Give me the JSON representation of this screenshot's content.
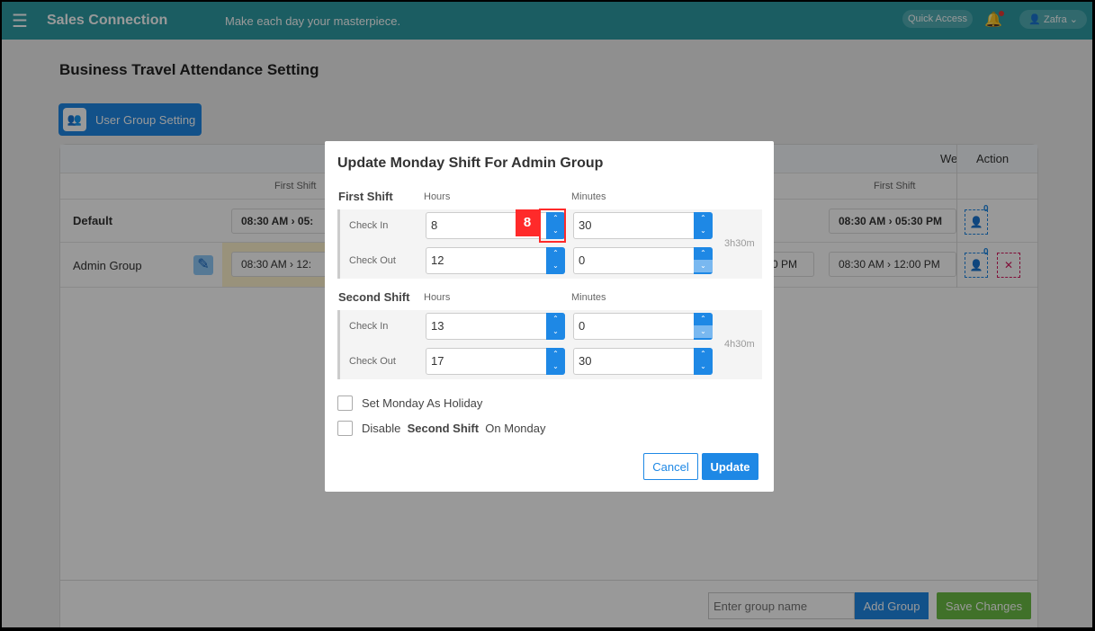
{
  "header": {
    "app_name": "Sales Connection",
    "tagline": "Make each day your masterpiece.",
    "quick_access": "Quick Access",
    "user": "Zafra",
    "colors": {
      "header": "#2d9ca3",
      "accent": "#1e88e5",
      "save": "#6bbd45",
      "marker": "#ff2a2a"
    }
  },
  "page": {
    "title": "Business Travel Attendance Setting",
    "user_group_button": "User Group Setting"
  },
  "table": {
    "right_day_header": "We",
    "action_header": "Action",
    "sub_header": "First Shift",
    "rows": [
      {
        "name": "Default",
        "left_time": "08:30 AM",
        "left_time_end": "05:",
        "right_start": "08:30 AM",
        "right_end": "05:30 PM",
        "count": "0"
      },
      {
        "name": "Admin Group",
        "left_time": "08:30 AM",
        "left_time_end": "12:",
        "mid_end": "0 PM",
        "right_start": "08:30 AM",
        "right_end": "12:00 PM",
        "count": "0"
      }
    ]
  },
  "footer": {
    "group_placeholder": "Enter group name",
    "add_group": "Add Group",
    "save_changes": "Save Changes"
  },
  "modal": {
    "title": "Update Monday Shift For Admin Group",
    "hours_label": "Hours",
    "minutes_label": "Minutes",
    "check_in": "Check In",
    "check_out": "Check Out",
    "first_shift": {
      "label": "First Shift",
      "in_hours": "8",
      "in_minutes": "30",
      "out_hours": "12",
      "out_minutes": "0",
      "duration": "3h30m"
    },
    "second_shift": {
      "label": "Second Shift",
      "in_hours": "13",
      "in_minutes": "0",
      "out_hours": "17",
      "out_minutes": "30",
      "duration": "4h30m"
    },
    "holiday_label": "Set Monday As Holiday",
    "disable_pre": "Disable ",
    "disable_bold": "Second Shift",
    "disable_post": " On Monday",
    "holiday_checked": false,
    "disable_checked": false,
    "cancel": "Cancel",
    "update": "Update"
  },
  "annotation": {
    "marker": "8"
  }
}
